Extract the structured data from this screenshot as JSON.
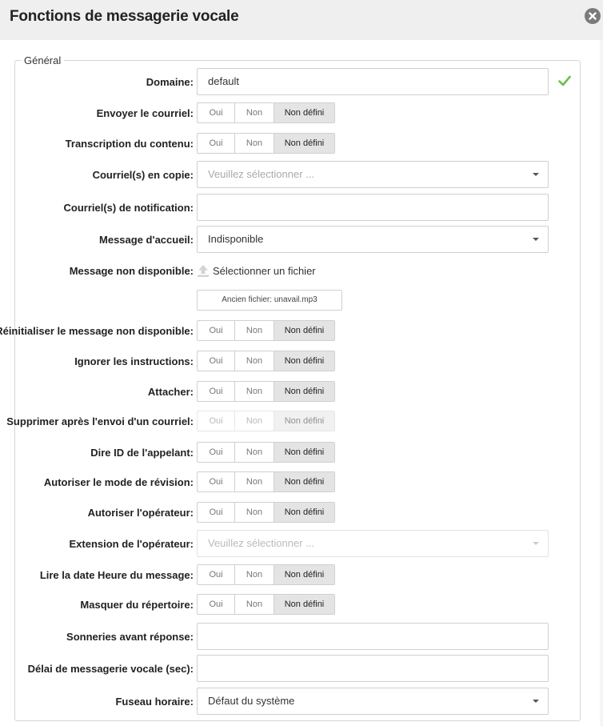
{
  "dialog": {
    "title": "Fonctions de messagerie vocale"
  },
  "section": {
    "legend": "Général"
  },
  "toggle": {
    "oui": "Oui",
    "non": "Non",
    "nd": "Non défini"
  },
  "fields": {
    "domaine": {
      "label": "Domaine:",
      "value": "default"
    },
    "envoyer_courriel": {
      "label": "Envoyer le courriel:",
      "selected": "Non défini"
    },
    "transcription": {
      "label": "Transcription du contenu:",
      "selected": "Non défini"
    },
    "courriel_copie": {
      "label": "Courriel(s) en copie:",
      "placeholder": "Veuillez sélectionner ..."
    },
    "courriel_notification": {
      "label": "Courriel(s) de notification:",
      "value": ""
    },
    "message_accueil": {
      "label": "Message d'accueil:",
      "value": "Indisponible"
    },
    "message_non_disponible": {
      "label": "Message non disponible:",
      "upload_label": "Sélectionner un fichier",
      "old_file": "Ancien fichier: unavail.mp3"
    },
    "reinitialiser": {
      "label": "Réinitialiser le message non disponible:",
      "selected": "Non défini"
    },
    "ignorer": {
      "label": "Ignorer les instructions:",
      "selected": "Non défini"
    },
    "attacher": {
      "label": "Attacher:",
      "selected": "Non défini"
    },
    "supprimer": {
      "label": "Supprimer après l'envoi d'un courriel:",
      "selected": "Non défini",
      "disabled": true
    },
    "dire_id": {
      "label": "Dire ID de l'appelant:",
      "selected": "Non défini"
    },
    "revision": {
      "label": "Autoriser le mode de révision:",
      "selected": "Non défini"
    },
    "operateur": {
      "label": "Autoriser l'opérateur:",
      "selected": "Non défini"
    },
    "extension_operateur": {
      "label": "Extension de l'opérateur:",
      "placeholder": "Veuillez sélectionner ...",
      "disabled": true
    },
    "lire_date": {
      "label": "Lire la date Heure du message:",
      "selected": "Non défini"
    },
    "masquer": {
      "label": "Masquer du répertoire:",
      "selected": "Non défini"
    },
    "sonneries": {
      "label": "Sonneries avant réponse:",
      "value": ""
    },
    "delai": {
      "label": "Délai de messagerie vocale (sec):",
      "value": ""
    },
    "fuseau": {
      "label": "Fuseau horaire:",
      "value": "Défaut du système"
    }
  },
  "colors": {
    "accent_check": "#6cc04a",
    "close": "#7b7b7b",
    "selected_bg": "#e4e4e4"
  },
  "icons": {
    "close": "close-icon",
    "check": "check-icon",
    "upload": "upload-icon",
    "caret": "chevron-down-icon"
  }
}
